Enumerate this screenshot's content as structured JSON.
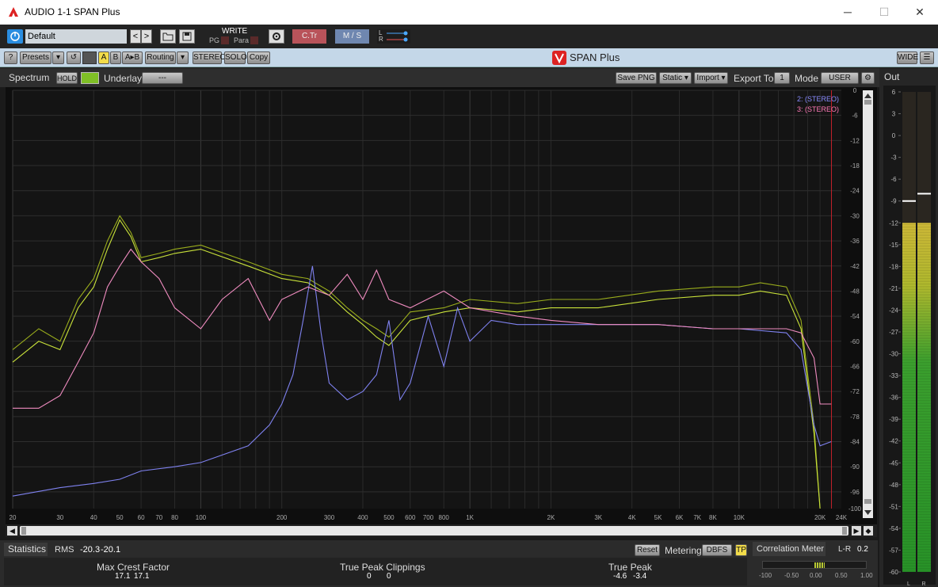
{
  "window": {
    "title": "AUDIO 1-1 SPAN Plus",
    "minimize": "─",
    "maximize": "☐",
    "close": "✕"
  },
  "host": {
    "preset_name": "Default",
    "prev": "<",
    "next": ">",
    "write_label": "WRITE",
    "pg_label": "PG",
    "para_label": "Para",
    "ctr_label": "C.Tr",
    "ms_label": "M / S",
    "l_label": "L",
    "r_label": "R"
  },
  "toolbar": {
    "help": "?",
    "presets": "Presets",
    "a": "A",
    "b": "B",
    "ab": "A▸B",
    "routing": "Routing",
    "stereo": "STEREO",
    "solo": "SOLO",
    "copy": "Copy",
    "plugin_title": "SPAN Plus",
    "wide": "WIDE"
  },
  "spectrum_header": {
    "title": "Spectrum",
    "hold": "HOLD",
    "underlay": "Underlay",
    "underlay_value": "---",
    "save_png": "Save PNG",
    "static": "Static ▾",
    "import": "Import ▾",
    "export_to": "Export To",
    "export_value": "1",
    "mode": "Mode",
    "mode_value": "USER"
  },
  "legend": [
    {
      "label": "2: (STEREO)",
      "color": "#8a8cff"
    },
    {
      "label": "3: (STEREO)",
      "color": "#ff7ab8"
    }
  ],
  "colors": {
    "yellow_dark": "#9aad1c",
    "yellow_light": "#c9e23a",
    "blue": "#7f82f0",
    "pink": "#f08cc0",
    "red_line": "#c0202a"
  },
  "freq_labels": [
    "20",
    "30",
    "40",
    "50",
    "60",
    "70",
    "80",
    "100",
    "200",
    "300",
    "400",
    "500",
    "600",
    "700",
    "800",
    "1K",
    "2K",
    "3K",
    "4K",
    "5K",
    "6K",
    "7K",
    "8K",
    "10K",
    "20K",
    "24K"
  ],
  "db_labels": [
    "0",
    "-6",
    "-12",
    "-18",
    "-24",
    "-30",
    "-36",
    "-42",
    "-48",
    "-54",
    "-60",
    "-66",
    "-72",
    "-78",
    "-84",
    "-90",
    "-96",
    "-100"
  ],
  "chart_data": {
    "type": "line",
    "xlabel": "",
    "ylabel": "",
    "x_scale": "log",
    "xlim": [
      20,
      24000
    ],
    "ylim": [
      -100,
      0
    ],
    "grid": true,
    "series": [
      {
        "name": "",
        "color": "#9aad1c",
        "x": [
          20,
          25,
          30,
          35,
          40,
          45,
          50,
          55,
          60,
          70,
          80,
          100,
          150,
          200,
          250,
          300,
          350,
          400,
          450,
          500,
          600,
          800,
          1000,
          1500,
          2000,
          3000,
          5000,
          8000,
          10000,
          12000,
          15000,
          17000,
          19000,
          20000
        ],
        "y": [
          -62,
          -57,
          -60,
          -50,
          -45,
          -36,
          -30,
          -34,
          -40,
          -39,
          -38,
          -37,
          -41,
          -44,
          -45,
          -48,
          -52,
          -55,
          -57,
          -59,
          -53,
          -52,
          -50,
          -51,
          -50,
          -50,
          -48,
          -47,
          -47,
          -46,
          -47,
          -55,
          -80,
          -100
        ]
      },
      {
        "name": "",
        "color": "#c9e23a",
        "x": [
          20,
          25,
          30,
          35,
          40,
          45,
          50,
          55,
          60,
          70,
          80,
          100,
          150,
          200,
          250,
          300,
          350,
          400,
          450,
          500,
          600,
          800,
          1000,
          1500,
          2000,
          3000,
          5000,
          8000,
          10000,
          12000,
          15000,
          17000,
          19000,
          20000
        ],
        "y": [
          -65,
          -60,
          -62,
          -52,
          -47,
          -38,
          -31,
          -35,
          -41,
          -40,
          -39,
          -38,
          -42,
          -45,
          -46,
          -49,
          -53,
          -56,
          -59,
          -61,
          -55,
          -53,
          -52,
          -53,
          -52,
          -52,
          -50,
          -49,
          -49,
          -48,
          -49,
          -57,
          -82,
          -100
        ]
      },
      {
        "name": "2: (STEREO)",
        "color": "#7f82f0",
        "x": [
          20,
          30,
          40,
          50,
          60,
          80,
          100,
          150,
          180,
          200,
          220,
          240,
          260,
          280,
          300,
          350,
          400,
          450,
          500,
          550,
          600,
          700,
          800,
          900,
          1000,
          1200,
          1500,
          2000,
          3000,
          5000,
          8000,
          10000,
          15000,
          17000,
          19000,
          20000,
          22000
        ],
        "y": [
          -97,
          -95,
          -94,
          -93,
          -91,
          -90,
          -89,
          -85,
          -80,
          -75,
          -68,
          -55,
          -42,
          -58,
          -70,
          -74,
          -72,
          -68,
          -55,
          -74,
          -70,
          -54,
          -66,
          -52,
          -60,
          -55,
          -56,
          -56,
          -56,
          -56,
          -57,
          -57,
          -58,
          -62,
          -80,
          -85,
          -84
        ]
      },
      {
        "name": "3: (STEREO)",
        "color": "#f08cc0",
        "x": [
          20,
          25,
          30,
          35,
          40,
          45,
          50,
          55,
          60,
          70,
          80,
          100,
          120,
          150,
          180,
          200,
          250,
          300,
          350,
          400,
          450,
          500,
          600,
          800,
          1000,
          1500,
          2000,
          3000,
          5000,
          8000,
          10000,
          15000,
          17000,
          19000,
          20000,
          22000
        ],
        "y": [
          -76,
          -76,
          -73,
          -65,
          -58,
          -47,
          -42,
          -38,
          -41,
          -45,
          -52,
          -57,
          -50,
          -45,
          -55,
          -50,
          -47,
          -49,
          -44,
          -50,
          -43,
          -50,
          -52,
          -48,
          -52,
          -54,
          -55,
          -56,
          -56,
          -57,
          -57,
          -57,
          -58,
          -64,
          -75,
          -75
        ]
      }
    ]
  },
  "statistics": {
    "tab": "Statistics",
    "rms_label": "RMS",
    "rms_l": "-20.3",
    "rms_r": "-20.1",
    "reset": "Reset",
    "metering": "Metering",
    "dbfs": "DBFS",
    "tp": "TP",
    "max_crest_label": "Max Crest Factor",
    "max_crest_l": "17.1",
    "max_crest_r": "17.1",
    "tp_clip_label": "True Peak Clippings",
    "tp_clip_l": "0",
    "tp_clip_r": "0",
    "true_peak_label": "True Peak",
    "true_peak_l": "-4.6",
    "true_peak_r": "-3.4"
  },
  "correlation": {
    "title": "Correlation Meter",
    "lr_label": "L-R",
    "lr_value": "0.2",
    "scale": [
      "-100",
      "-0.50",
      "0.00",
      "0.50",
      "1.00"
    ],
    "value": 0.2
  },
  "out_meter": {
    "title": "Out",
    "scale": [
      "6",
      "3",
      "0",
      "-3",
      "-6",
      "-9",
      "-12",
      "-15",
      "-18",
      "-21",
      "-24",
      "-27",
      "-30",
      "-33",
      "-36",
      "-39",
      "-42",
      "-45",
      "-48",
      "-51",
      "-54",
      "-57",
      "-60"
    ],
    "level_db": -12,
    "peak_l_db": -9,
    "peak_r_db": -8,
    "l_label": "L",
    "r_label": "R"
  }
}
